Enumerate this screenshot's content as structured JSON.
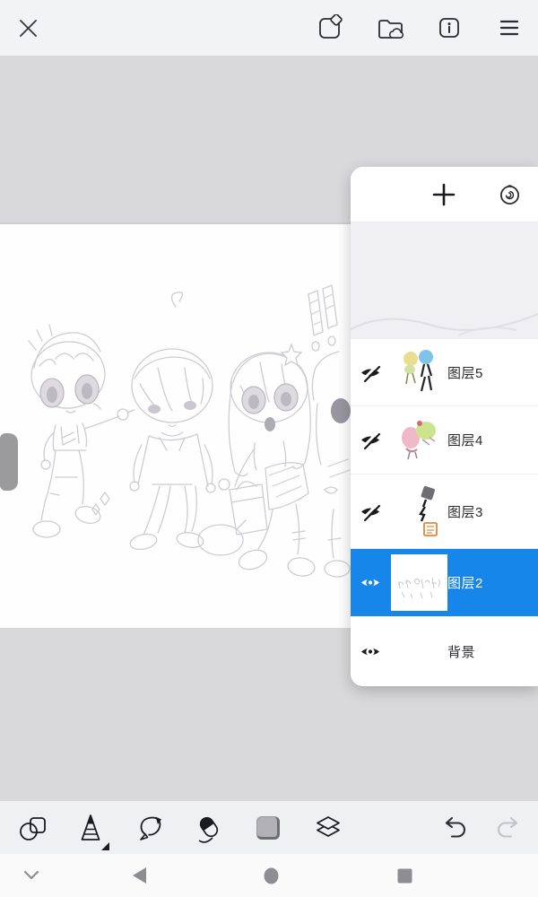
{
  "app": {
    "name": "drawing-app-canvas-screen"
  },
  "topbar": {
    "icons": [
      "close-x",
      "export-document",
      "cloud-folder",
      "info",
      "menu"
    ]
  },
  "layers_panel": {
    "header_icons": [
      "add-layer-plus",
      "layer-options-spiral"
    ],
    "layers": [
      {
        "name": "图层5",
        "visible": false,
        "selected": false,
        "thumbnail": "colorful-chibi-sketch"
      },
      {
        "name": "图层4",
        "visible": false,
        "selected": false,
        "thumbnail": "pink-green-chibi-sketch"
      },
      {
        "name": "图层3",
        "visible": false,
        "selected": false,
        "thumbnail": "dark-figure-orange-stamp"
      },
      {
        "name": "图层2",
        "visible": true,
        "selected": true,
        "thumbnail": "white-pencil-sketch"
      },
      {
        "name": "背景",
        "visible": true,
        "selected": false,
        "thumbnail": "none"
      }
    ]
  },
  "canvas": {
    "content": "four chibi character pencil sketches on white canvas",
    "background": "#fefefe"
  },
  "toolbar": {
    "tools": [
      "shape-tool",
      "brush-tool",
      "lasso-tool",
      "eraser-tool",
      "color-swatch",
      "layers-tool"
    ],
    "selected_tool": "brush-tool",
    "color_swatch_color": "#b2b2b6",
    "undo_enabled": true,
    "redo_enabled": false
  },
  "navbar": {
    "icons": [
      "collapse-chevron",
      "back-triangle",
      "home-circle",
      "recents-square"
    ]
  },
  "colors": {
    "accent_blue": "#1786ea",
    "canvas_surround": "#d9d9db",
    "topbar_bg": "#f2f3f5",
    "toolbar_bg": "#eef0f2",
    "navbar_bg": "#fafafa"
  }
}
